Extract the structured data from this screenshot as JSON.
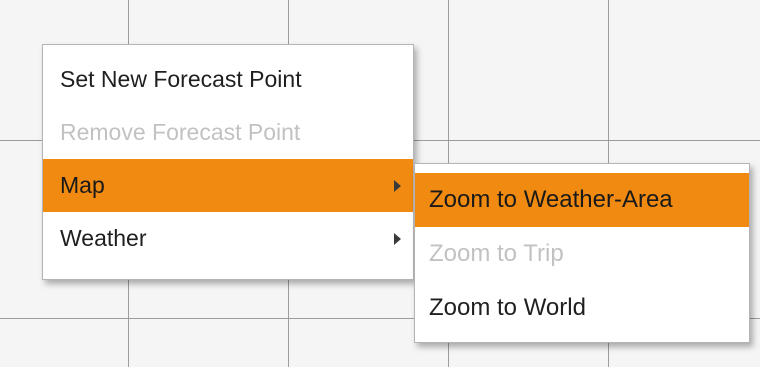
{
  "context_menu": {
    "items": [
      {
        "label": "Set New Forecast Point",
        "enabled": true,
        "submenu": false
      },
      {
        "label": "Remove Forecast Point",
        "enabled": false,
        "submenu": false
      },
      {
        "label": "Map",
        "enabled": true,
        "submenu": true,
        "highlighted": true
      },
      {
        "label": "Weather",
        "enabled": true,
        "submenu": true
      }
    ]
  },
  "map_submenu": {
    "items": [
      {
        "label": "Zoom to Weather-Area",
        "enabled": true,
        "highlighted": true
      },
      {
        "label": "Zoom to Trip",
        "enabled": false
      },
      {
        "label": "Zoom to World",
        "enabled": true
      }
    ]
  },
  "colors": {
    "highlight": "#f08a10",
    "disabled_text": "#c2c2c2",
    "grid_line": "#9c9c9c"
  },
  "icons": {
    "submenu_arrow": "chevron-right-icon"
  }
}
